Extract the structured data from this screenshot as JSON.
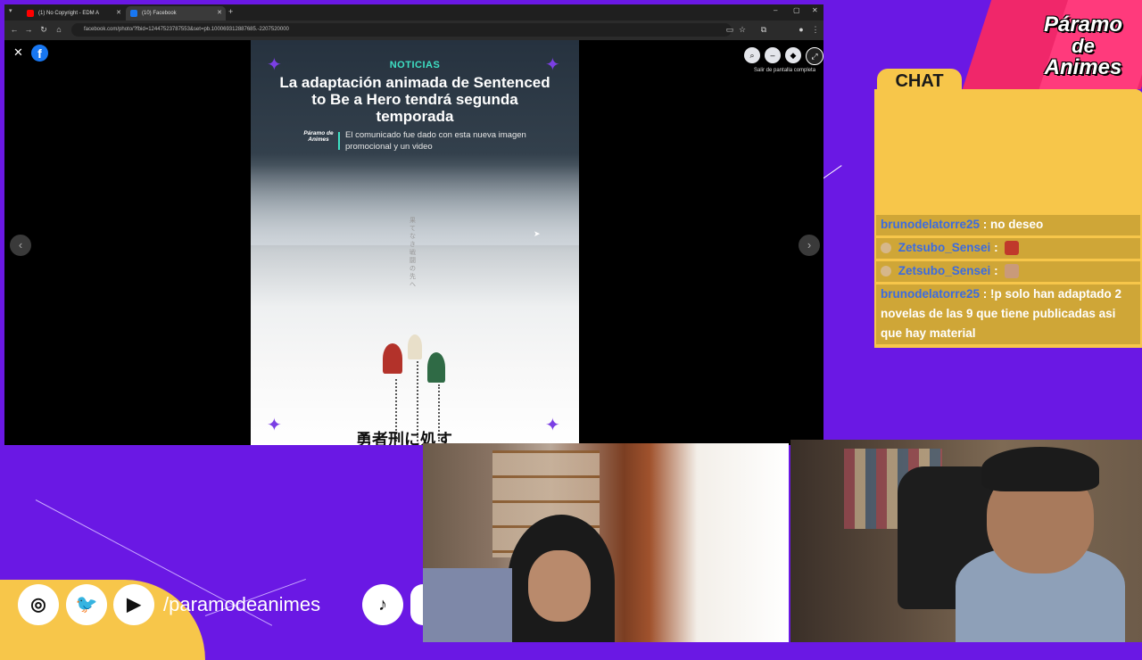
{
  "browser": {
    "tabs": [
      {
        "label": "(1) No Copyright - EDM A",
        "active": false
      },
      {
        "label": "(10) Facebook",
        "active": true
      }
    ],
    "url": "facebook.com/photo/?fbid=12447523787553&set=pb.100069312887685.-2207520000"
  },
  "viewer": {
    "exit_fullscreen": "Salir de pantalla completa"
  },
  "poster": {
    "tag": "NOTICIAS",
    "title": "La adaptación animada de Sentenced to Be a Hero tendrá segunda temporada",
    "logo": "Páramo de Animes",
    "subtitle": "El comunicado fue dado con esta nueva imagen promocional y un video",
    "vertical_text": "果てなき戦闘の先へ",
    "jp_title": "勇者刑に処す"
  },
  "chat": {
    "title": "CHAT",
    "messages": [
      {
        "user": "brunodelatorre25",
        "text": ": no deseo",
        "badge": false,
        "emote": null
      },
      {
        "user": "Zetsubo_Sensei",
        "text": ":",
        "badge": true,
        "emote": "red"
      },
      {
        "user": "Zetsubo_Sensei",
        "text": ":",
        "badge": true,
        "emote": "face"
      },
      {
        "user": "brunodelatorre25",
        "text": ": !p solo han adaptado 2 novelas de las 9 que tiene publicadas asi que hay material",
        "badge": false,
        "emote": null
      }
    ]
  },
  "brand": {
    "line1": "Páramo",
    "line2": "de",
    "line3": "Animes"
  },
  "socials": {
    "handle": "/paramodeanimes"
  },
  "colors": {
    "background": "#6a18e4",
    "chat_yellow": "#f7c64a",
    "accent_pink": "#f0276a",
    "teal": "#3ee0c4",
    "sparkle_purple": "#7b3fe4"
  }
}
